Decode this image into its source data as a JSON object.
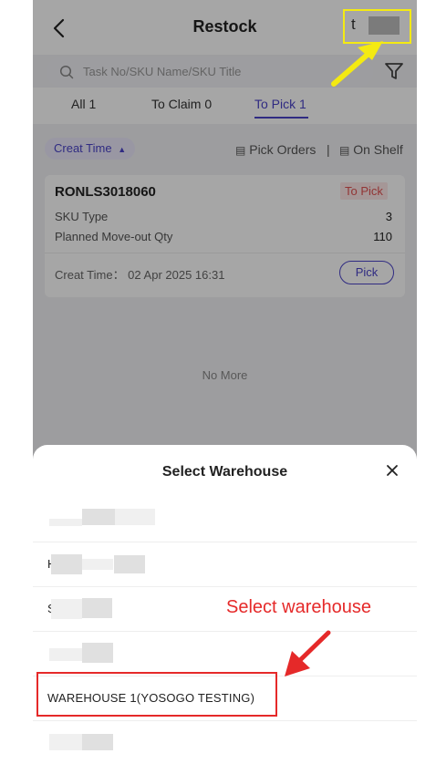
{
  "header": {
    "title": "Restock",
    "warehouse_short": "t",
    "back_icon": "chevron-left-icon"
  },
  "search": {
    "placeholder": "Task No/SKU Name/SKU Title"
  },
  "tabs": [
    {
      "label": "All 1",
      "active": false
    },
    {
      "label": "To Claim 0",
      "active": false
    },
    {
      "label": "To Pick 1",
      "active": true
    }
  ],
  "sortbar": {
    "sort_label": "Creat Time",
    "pick_orders": "Pick Orders",
    "on_shelf": "On Shelf"
  },
  "card": {
    "task_no": "RONLS3018060",
    "status": "To Pick",
    "rows": [
      {
        "label": "SKU Type",
        "value": "3"
      },
      {
        "label": "Planned Move-out Qty",
        "value": "110"
      }
    ],
    "created": "Creat Time： 02 Apr 2025 16:31",
    "pick_label": "Pick"
  },
  "list_end": "No More",
  "sheet": {
    "title": "Select Warehouse",
    "items": [
      {
        "label": ""
      },
      {
        "label": "H"
      },
      {
        "label": "S"
      },
      {
        "label": ""
      },
      {
        "label": "WAREHOUSE 1(YOSOGO TESTING)"
      },
      {
        "label": ""
      }
    ]
  },
  "annotation": {
    "text": "Select warehouse"
  },
  "colors": {
    "accent": "#4a43c8",
    "status_red": "#e05252",
    "annotation_red": "#e52929",
    "highlight_yellow": "#f4ea12"
  }
}
